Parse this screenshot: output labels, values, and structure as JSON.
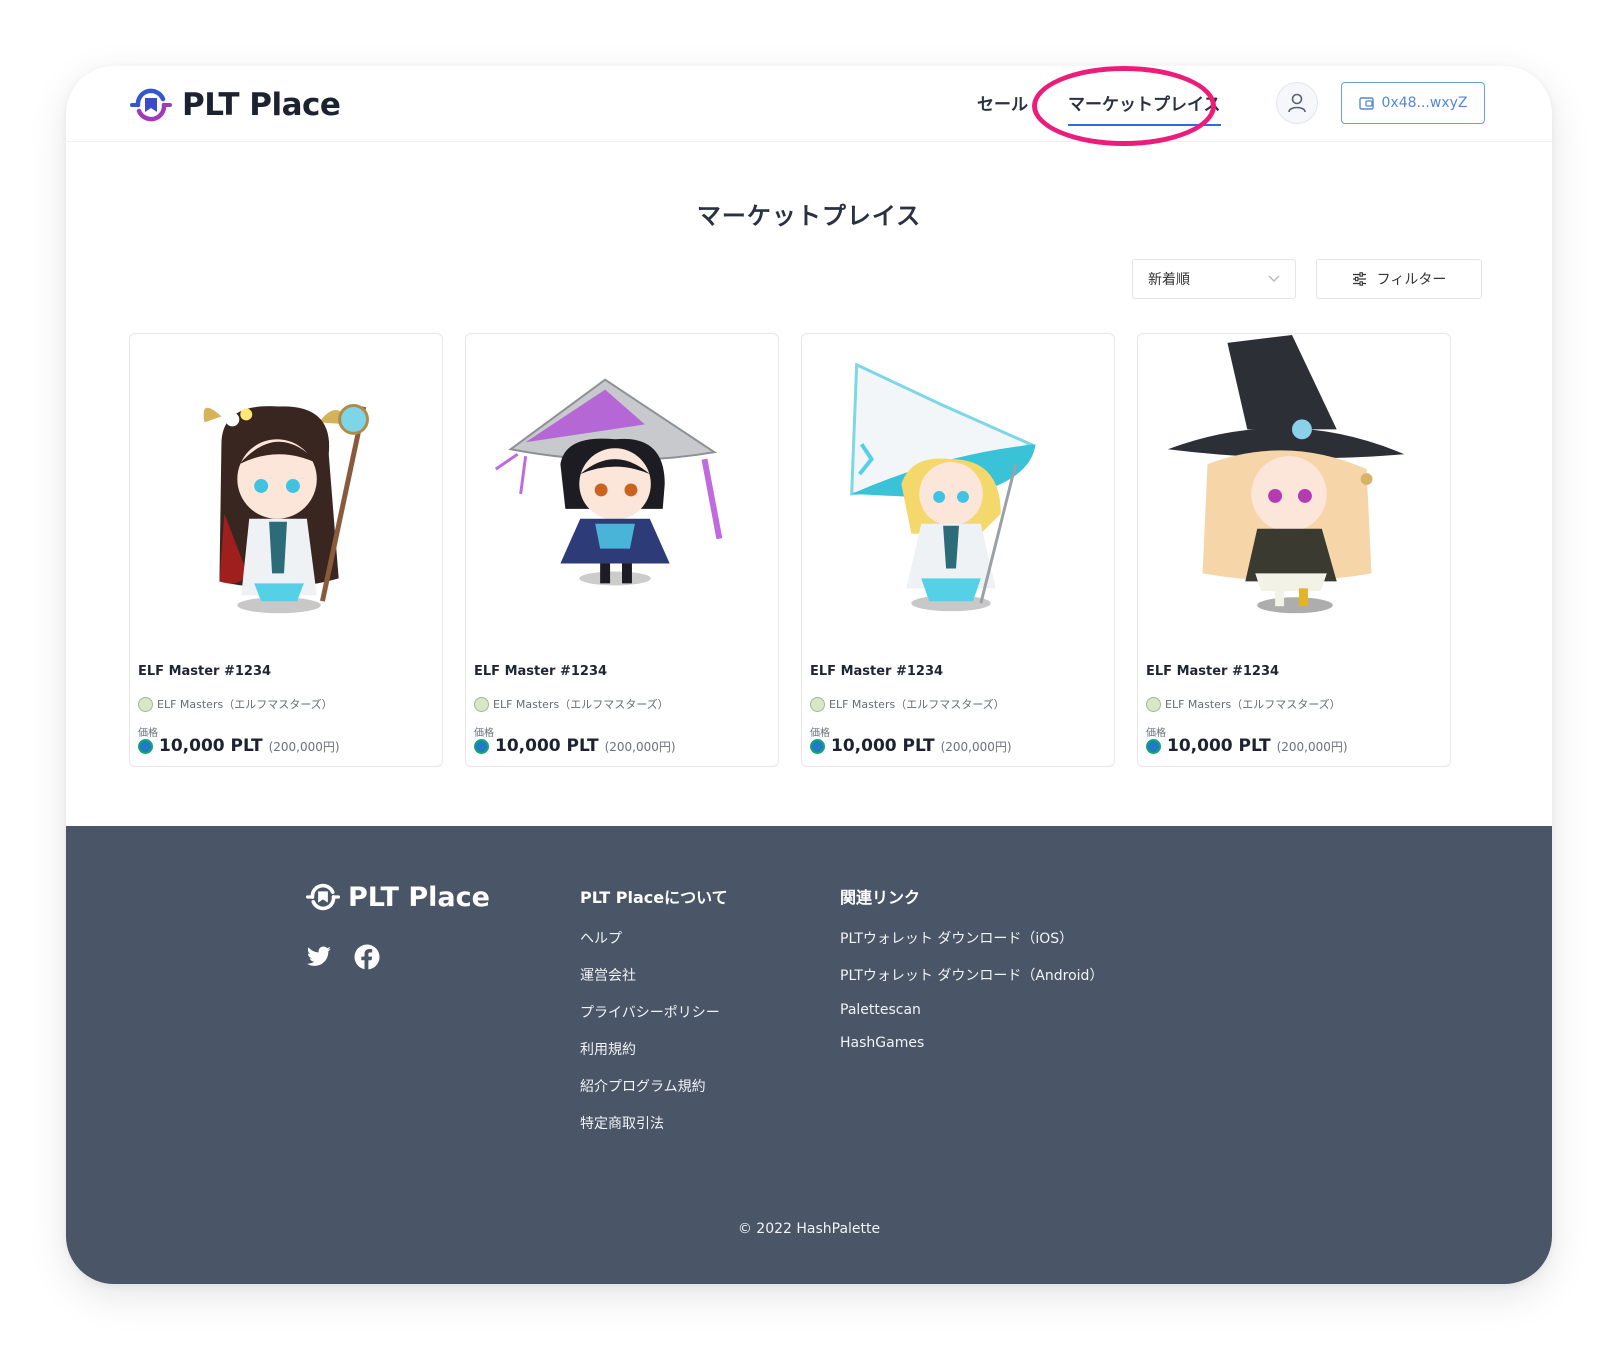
{
  "brand": {
    "name": "PLT Place"
  },
  "nav": {
    "sale": "セール",
    "marketplace": "マーケットプレイス",
    "wallet": "0x48...wxyZ"
  },
  "page": {
    "title": "マーケットプレイス"
  },
  "controls": {
    "sort_value": "新着順",
    "filter_label": "フィルター"
  },
  "colors": {
    "accent": "#2e6be0",
    "annotation": "#ec1c7a",
    "footer_bg": "#4a5568"
  },
  "cards": [
    {
      "name": "ELF Master #1234",
      "collection": "ELF Masters（エルフマスターズ）",
      "price_label": "価格",
      "price": "10,000 PLT",
      "price_yen": "(200,000円)"
    },
    {
      "name": "ELF Master #1234",
      "collection": "ELF Masters（エルフマスターズ）",
      "price_label": "価格",
      "price": "10,000 PLT",
      "price_yen": "(200,000円)"
    },
    {
      "name": "ELF Master #1234",
      "collection": "ELF Masters（エルフマスターズ）",
      "price_label": "価格",
      "price": "10,000 PLT",
      "price_yen": "(200,000円)"
    },
    {
      "name": "ELF Master #1234",
      "collection": "ELF Masters（エルフマスターズ）",
      "price_label": "価格",
      "price": "10,000 PLT",
      "price_yen": "(200,000円)"
    }
  ],
  "footer": {
    "brand": "PLT Place",
    "about": {
      "heading": "PLT Placeについて",
      "links": [
        "ヘルプ",
        "運営会社",
        "プライバシーポリシー",
        "利用規約",
        "紹介プログラム規約",
        "特定商取引法"
      ]
    },
    "related": {
      "heading": "関連リンク",
      "links": [
        "PLTウォレット ダウンロード（iOS）",
        "PLTウォレット ダウンロード（Android）",
        "Palettescan",
        "HashGames"
      ]
    },
    "copyright": "© 2022 HashPalette"
  }
}
